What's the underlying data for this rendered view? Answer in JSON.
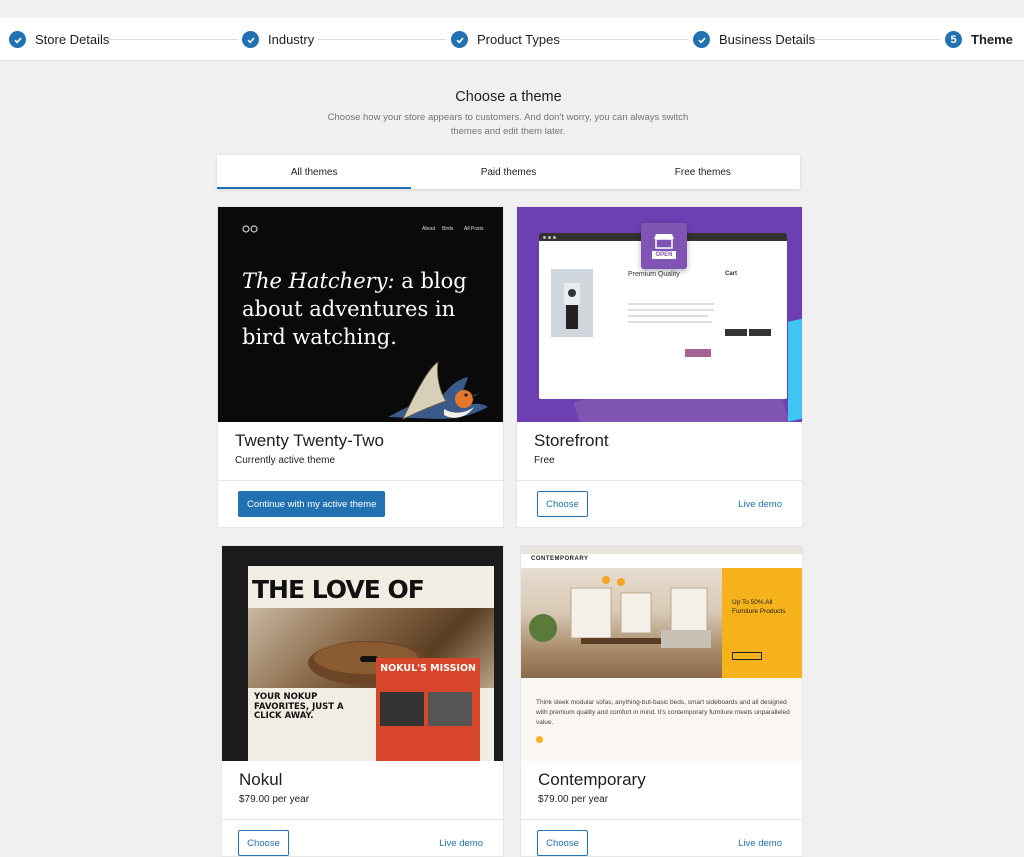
{
  "stepper": {
    "steps": [
      {
        "label": "Store Details",
        "state": "done"
      },
      {
        "label": "Industry",
        "state": "done"
      },
      {
        "label": "Product Types",
        "state": "done"
      },
      {
        "label": "Business Details",
        "state": "done"
      },
      {
        "label": "Theme",
        "state": "current",
        "number": "5"
      }
    ]
  },
  "page": {
    "heading": "Choose a theme",
    "subheading": "Choose how your store appears to customers. And don't worry, you can always switch themes and edit them later."
  },
  "tabs": [
    {
      "label": "All themes",
      "active": true
    },
    {
      "label": "Paid themes",
      "active": false
    },
    {
      "label": "Free themes",
      "active": false
    }
  ],
  "themes": [
    {
      "name": "Twenty Twenty-Two",
      "status": "Currently active theme",
      "primary_action": "Continue with my active theme",
      "thumb": {
        "nav": [
          "About",
          "Birds",
          "All Posts"
        ],
        "headline_italic": "The Hatchery:",
        "headline_rest": "a blog about adventures in bird watching."
      }
    },
    {
      "name": "Storefront",
      "status": "Free",
      "primary_action": "Choose",
      "demo_link": "Live demo",
      "thumb": {
        "badge": "OPEN",
        "product": "Premium Quality",
        "cart": "Cart"
      }
    },
    {
      "name": "Nokul",
      "status": "$79.00 per year",
      "primary_action": "Choose",
      "demo_link": "Live demo",
      "thumb": {
        "title": "THE LOVE OF BREAD",
        "sub": "YOUR NOKUP FAVORITES, JUST A CLICK AWAY.",
        "mission": "NOKUL'S MISSION"
      }
    },
    {
      "name": "Contemporary",
      "status": "$79.00 per year",
      "primary_action": "Choose",
      "demo_link": "Live demo",
      "thumb": {
        "logo": "CONTEMPORARY",
        "promo": "Up To 50% All Furniture Products",
        "description": "Think sleek modular sofas, anything-but-basic beds, smart sideboards and all designed with premium quality and comfort in mind. It's contemporary furniture meets unparalleled value."
      }
    }
  ],
  "colors": {
    "accent": "#2271b1",
    "background": "#f0f0f1"
  }
}
